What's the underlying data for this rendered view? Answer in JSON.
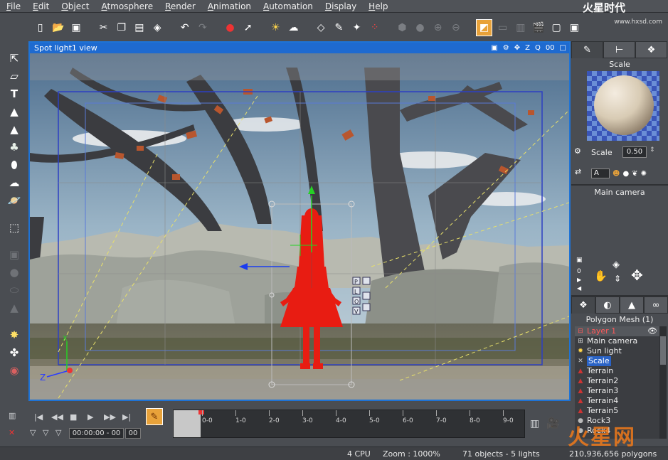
{
  "menubar": {
    "items": [
      "File",
      "Edit",
      "Object",
      "Atmosphere",
      "Render",
      "Animation",
      "Automation",
      "Display",
      "Help"
    ]
  },
  "logo": {
    "text": "火星时代",
    "url": "www.hxsd.com"
  },
  "viewport": {
    "title": "Spot light1 view",
    "controls": [
      "Z",
      "Q",
      "00"
    ],
    "axis_z": "Z",
    "axis_x": "X",
    "gizmo_labels": [
      "P",
      "L",
      "O",
      "V"
    ]
  },
  "timeline": {
    "timecode": "00:00:00 - 00",
    "frame_field": "00",
    "ticks": [
      "0-0",
      "1-0",
      "2-0",
      "3-0",
      "4-0",
      "5-0",
      "6-0",
      "7-0",
      "8-0",
      "9-0"
    ]
  },
  "statusbar": {
    "cpu": "4 CPU",
    "zoom": "Zoom : 1000%",
    "objects": "71 objects - 5 lights",
    "polygons": "210,936,656 polygons"
  },
  "watermark": "火星网",
  "rightpanel": {
    "material_header": "Scale",
    "scale_label": "Scale",
    "scale_value": "0.50",
    "channel_value": "A",
    "camera_header": "Main camera",
    "cam_counter": "0",
    "tree_header": "Polygon Mesh (1)",
    "tree": [
      {
        "label": "Layer 1",
        "kind": "layer"
      },
      {
        "label": "Main camera",
        "kind": "camera"
      },
      {
        "label": "Sun light",
        "kind": "light"
      },
      {
        "label": "Scale",
        "kind": "selected"
      },
      {
        "label": "Terrain",
        "kind": "terrain"
      },
      {
        "label": "Terrain2",
        "kind": "terrain"
      },
      {
        "label": "Terrain3",
        "kind": "terrain"
      },
      {
        "label": "Terrain4",
        "kind": "terrain"
      },
      {
        "label": "Terrain5",
        "kind": "terrain"
      },
      {
        "label": "Rock3",
        "kind": "rock"
      },
      {
        "label": "Rock4",
        "kind": "rock"
      }
    ]
  },
  "colors": {
    "accent": "#1e6ad0",
    "active_tool": "#e8a23a",
    "selection": "#2a63c6",
    "layer_text": "#ff5a5a"
  }
}
